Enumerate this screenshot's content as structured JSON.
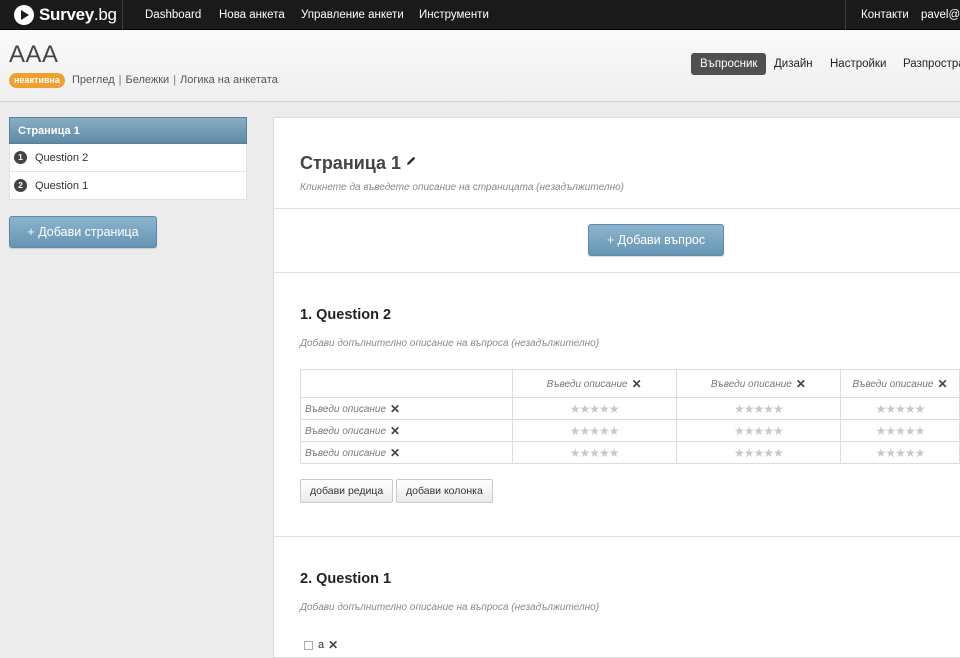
{
  "topnav": {
    "logo": {
      "name": "Survey",
      "tld": ".bg"
    },
    "items": [
      "Dashboard",
      "Нова анкета",
      "Управление анкети",
      "Инструменти"
    ],
    "contacts": "Контакти",
    "user": "pavel@c"
  },
  "header": {
    "title": "AAA",
    "status": "неактивна",
    "links": [
      "Преглед",
      "Бележки",
      "Логика на анкетата"
    ],
    "tabs": [
      {
        "label": "Въпросник",
        "active": true
      },
      {
        "label": "Дизайн",
        "active": false
      },
      {
        "label": "Настройки",
        "active": false
      },
      {
        "label": "Разпростра",
        "active": false
      }
    ]
  },
  "sidebar": {
    "page_label": "Страница 1",
    "items": [
      {
        "num": "1",
        "label": "Question 2"
      },
      {
        "num": "2",
        "label": "Question 1"
      }
    ],
    "add_page": "+ Добави страница"
  },
  "main": {
    "page_title": "Страница 1",
    "page_desc": "Кликнете да въведете описание на страницата (незадължително)",
    "add_question": "+ Добави въпрос",
    "questions": [
      {
        "title": "1. Question 2",
        "desc": "Добави допълнително описание на въпроса (незадължително)",
        "columns": [
          "Въведи описание",
          "Въведи описание",
          "Въведи описание"
        ],
        "rows": [
          "Въведи описание",
          "Въведи описание",
          "Въведи описание"
        ],
        "star_glyphs": "★★★★★",
        "add_row": "добави редица",
        "add_column": "добави колонка"
      },
      {
        "title": "2. Question 1",
        "desc": "Добави допълнително описание на въпроса (незадължително)",
        "option": "a"
      }
    ]
  },
  "colors": {
    "accent_blue": "#6596b4",
    "status_orange": "#f0a030",
    "nav_dark": "#1a1a1a"
  }
}
